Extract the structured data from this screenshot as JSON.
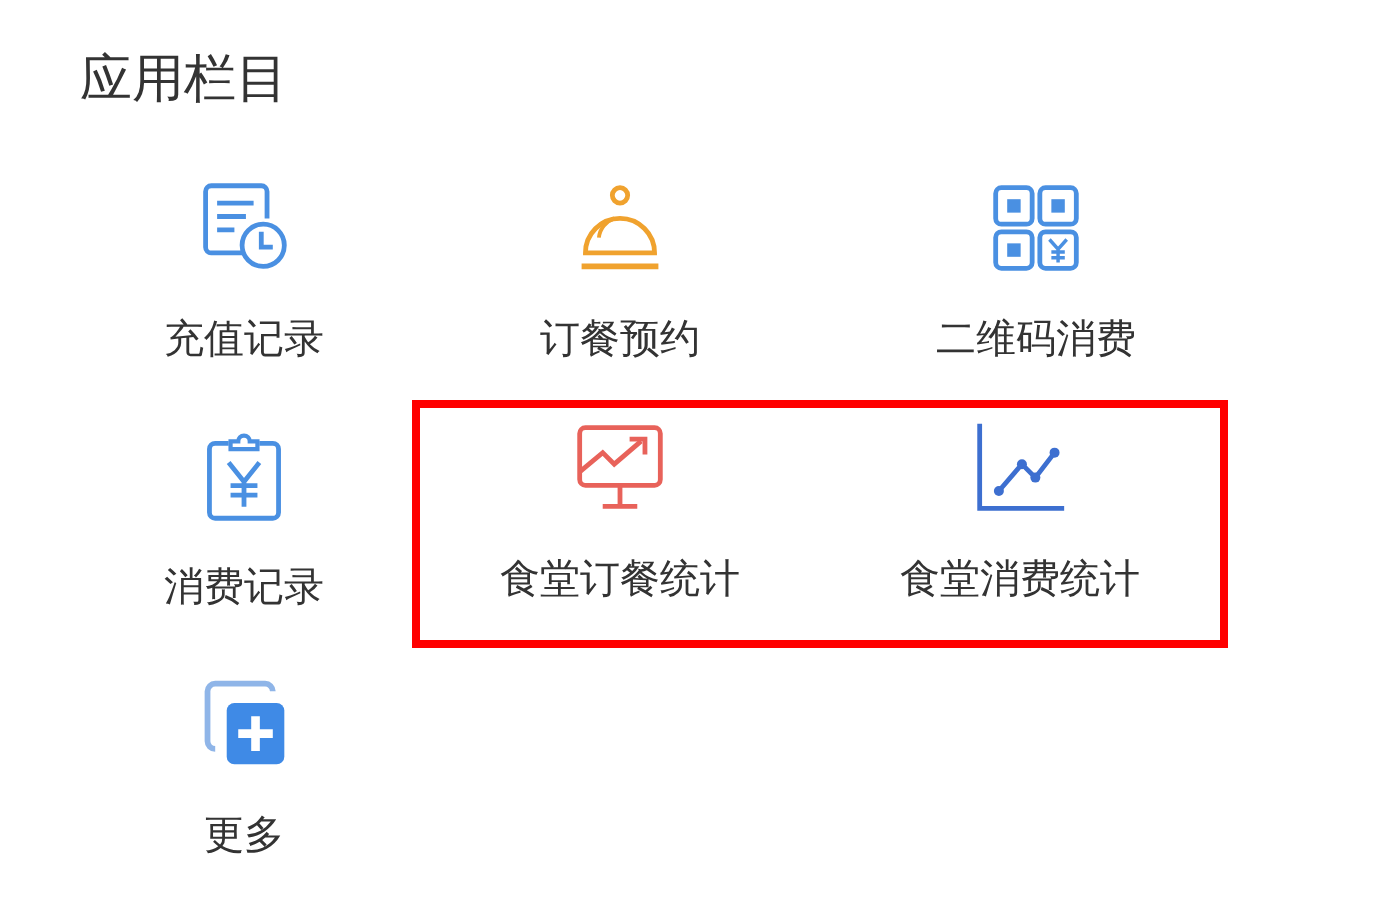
{
  "title": "应用栏目",
  "rows": [
    [
      {
        "label": "充值记录",
        "kind": "record",
        "highlighted": false
      },
      {
        "label": "订餐预约",
        "kind": "bell",
        "highlighted": false
      },
      {
        "label": "二维码消费",
        "kind": "qr",
        "highlighted": false
      }
    ],
    [
      {
        "label": "消费记录",
        "kind": "clipboard",
        "highlighted": false
      },
      {
        "label": "食堂订餐统计",
        "kind": "monitor",
        "highlighted": true
      },
      {
        "label": "食堂消费统计",
        "kind": "linechart",
        "highlighted": true
      }
    ],
    [
      {
        "label": "更多",
        "kind": "more",
        "highlighted": false
      }
    ]
  ]
}
